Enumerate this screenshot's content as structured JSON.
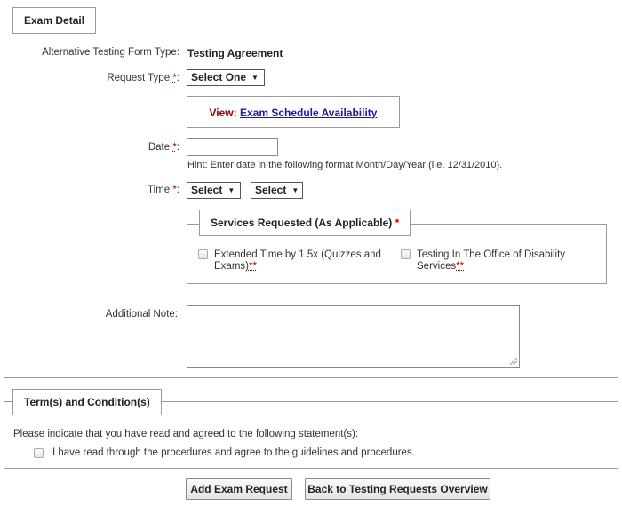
{
  "exam_detail": {
    "legend": "Exam Detail",
    "alt_form_label": "Alternative Testing Form Type:",
    "alt_form_value": "Testing Agreement",
    "request_type_label": "Request Type",
    "request_type_value": "Select One",
    "view_label": "View:",
    "view_link": "Exam Schedule Availability",
    "date_label": "Date",
    "date_value": "",
    "date_hint": "Hint: Enter date in the following format Month/Day/Year (i.e. 12/31/2010).",
    "time_label": "Time",
    "time_hour": "Select",
    "time_minute": "Select",
    "services": {
      "legend": "Services Requested (As Applicable)",
      "opt1": "Extended Time by 1.5x (Quizzes and Exams)",
      "opt2": "Testing In The Office of Disability Services"
    },
    "additional_note_label": "Additional Note:",
    "additional_note_value": ""
  },
  "terms": {
    "legend": "Term(s) and Condition(s)",
    "instruction": "Please indicate that you have read and agreed to the following statement(s):",
    "agree_label": "I have read through the procedures and agree to the guidelines and procedures."
  },
  "buttons": {
    "add": "Add Exam Request",
    "back": "Back to Testing Requests Overview"
  },
  "markers": {
    "required": "*",
    "colon": ":",
    "footnote": "**"
  }
}
